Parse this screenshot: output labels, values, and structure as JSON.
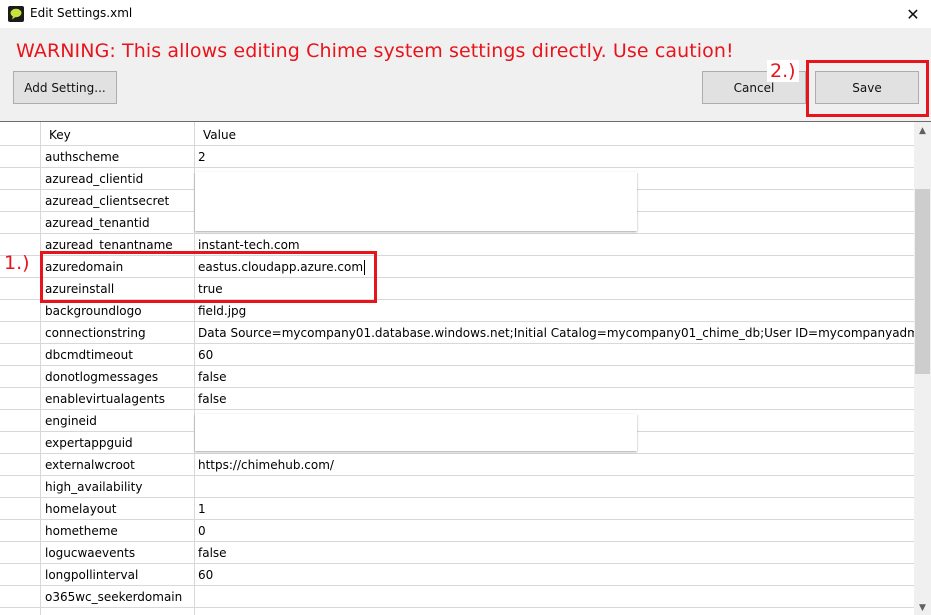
{
  "window": {
    "title": "Edit Settings.xml",
    "close_glyph": "✕",
    "icon": "chat-bubble-icon"
  },
  "header": {
    "warning": "WARNING: This allows editing Chime system settings directly.  Use caution!",
    "add_label": "Add Setting...",
    "cancel_label": "Cancel",
    "save_label": "Save"
  },
  "annotations": {
    "step1": "1.)",
    "step2": "2.)",
    "color": "#e8141c"
  },
  "grid": {
    "columns": [
      "Key",
      "Value"
    ],
    "rows": [
      {
        "key": "authscheme",
        "value": "2"
      },
      {
        "key": "azuread_clientid",
        "value": ""
      },
      {
        "key": "azuread_clientsecret",
        "value": ""
      },
      {
        "key": "azuread_tenantid",
        "value": ""
      },
      {
        "key": "azuread_tenantname",
        "value": "instant-tech.com"
      },
      {
        "key": "azuredomain",
        "value": "eastus.cloudapp.azure.com"
      },
      {
        "key": "azureinstall",
        "value": "true"
      },
      {
        "key": "backgroundlogo",
        "value": "field.jpg"
      },
      {
        "key": "connectionstring",
        "value": "Data Source=mycompany01.database.windows.net;Initial Catalog=mycompany01_chime_db;User ID=mycompanyadmin;P..."
      },
      {
        "key": "dbcmdtimeout",
        "value": "60"
      },
      {
        "key": "donotlogmessages",
        "value": "false"
      },
      {
        "key": "enablevirtualagents",
        "value": "false"
      },
      {
        "key": "engineid",
        "value": ""
      },
      {
        "key": "expertappguid",
        "value": ""
      },
      {
        "key": "externalwcroot",
        "value": "https://chimehub.com/"
      },
      {
        "key": "high_availability",
        "value": ""
      },
      {
        "key": "homelayout",
        "value": "1"
      },
      {
        "key": "hometheme",
        "value": "0"
      },
      {
        "key": "logucwaevents",
        "value": "false"
      },
      {
        "key": "longpollinterval",
        "value": "60"
      },
      {
        "key": "o365wc_seekerdomain",
        "value": ""
      },
      {
        "key": "",
        "value": ""
      }
    ]
  }
}
